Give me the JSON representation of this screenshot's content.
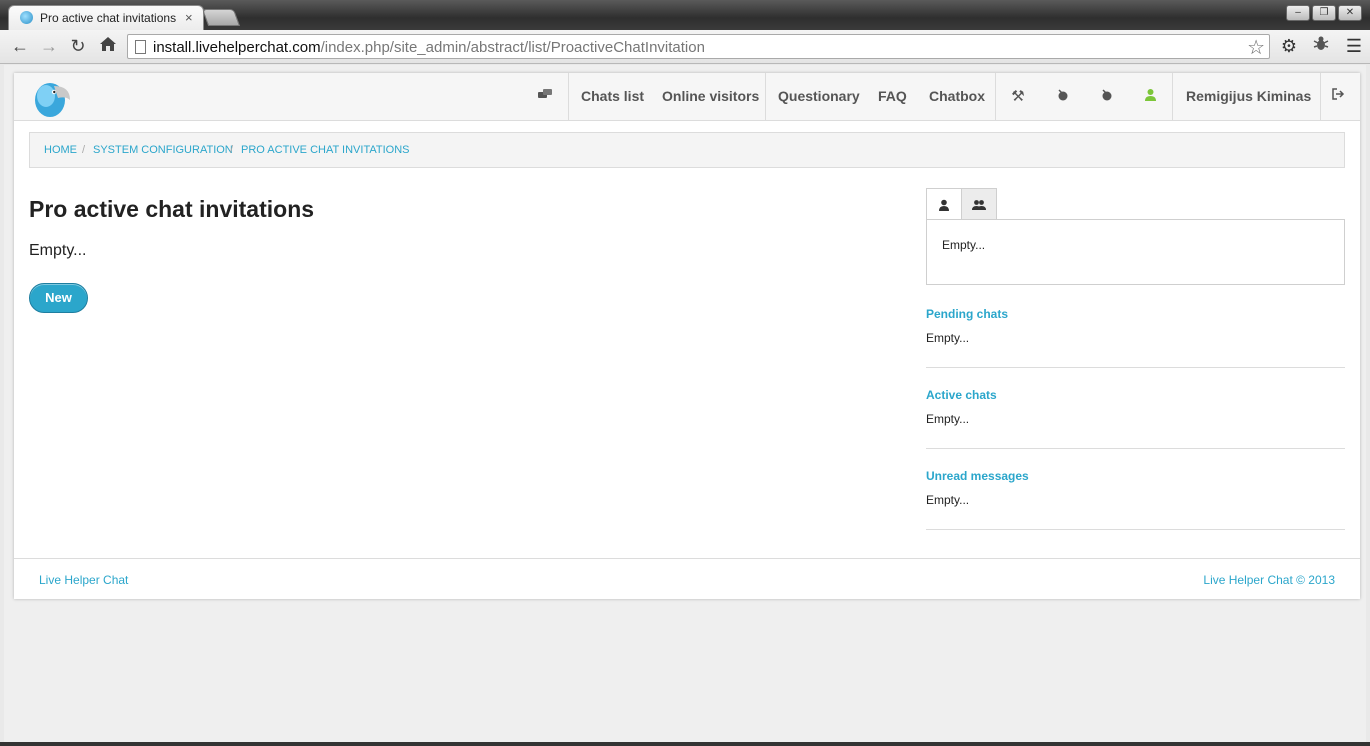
{
  "browser": {
    "tab_title": "Pro active chat invitations",
    "tab_close": "×",
    "url_host": "install.livehelperchat.com",
    "url_path": "/index.php/site_admin/abstract/list/ProactiveChatInvitation",
    "back_icon": "back-arrow-icon",
    "forward_icon": "forward-arrow-icon",
    "reload_icon": "reload-icon",
    "home_icon": "home-icon",
    "star_icon": "star-icon",
    "settings_icon": "gear-icon",
    "extension_icon": "bug-icon",
    "menu_icon": "menu-icon"
  },
  "nav": {
    "chats_icon": "chat-bubbles-icon",
    "chats_list": "Chats list",
    "online_visitors": "Online visitors",
    "questionary": "Questionary",
    "faq": "FAQ",
    "chatbox": "Chatbox",
    "user_name": "Remigijus Kiminas",
    "user_status_color": "#7cc639"
  },
  "breadcrumb": {
    "home": "Home",
    "system_configuration": "System configuration",
    "current": "Pro active chat invitations",
    "separator": "/"
  },
  "main": {
    "title": "Pro active chat invitations",
    "empty_text": "Empty...",
    "new_button": "New"
  },
  "sidebar": {
    "tab_panel_text": "Empty...",
    "pending_title": "Pending chats",
    "pending_text": "Empty...",
    "active_title": "Active chats",
    "active_text": "Empty...",
    "unread_title": "Unread messages",
    "unread_text": "Empty..."
  },
  "footer": {
    "left": "Live Helper Chat",
    "right": "Live Helper Chat © 2013"
  },
  "colors": {
    "accent": "#2ba6cb"
  }
}
